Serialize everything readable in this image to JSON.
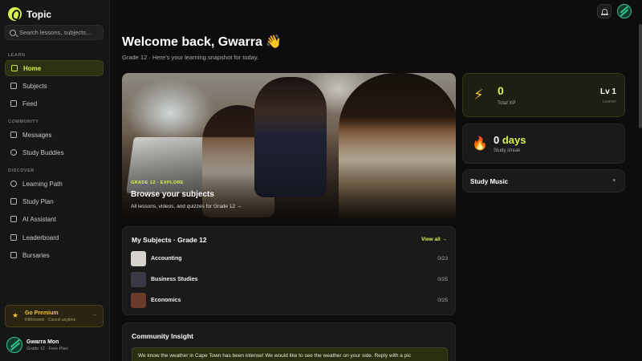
{
  "app": {
    "name": "Topic"
  },
  "search": {
    "placeholder": "Search lessons, subjects..."
  },
  "sidebar": {
    "sections": [
      {
        "label": "LEARN",
        "items": [
          "Home",
          "Subjects",
          "Feed"
        ]
      },
      {
        "label": "COMMUNITY",
        "items": [
          "Messages",
          "Study Buddies"
        ]
      },
      {
        "label": "DISCOVER",
        "items": [
          "Learning Path",
          "Study Plan",
          "AI Assistant",
          "Leaderboard",
          "Bursaries"
        ]
      }
    ],
    "active_item": "Home",
    "premium": {
      "title": "Go Premium",
      "subtitle": "R60/month · Cancel anytime",
      "arrow": "→"
    },
    "user": {
      "name": "Gwarra Mon",
      "plan": "Grade 12 · Free Plan"
    }
  },
  "header": {
    "title": "Welcome back, Gwarra 👋",
    "subtitle": "Grade 12 · Here's your learning snapshot for today."
  },
  "hero": {
    "tag": "GRADE 12 · EXPLORE",
    "title": "Browse your subjects",
    "subtitle": "All lessons, videos, and quizzes for Grade 12 →"
  },
  "subjects": {
    "title": "My Subjects · Grade 12",
    "view_all": "View all →",
    "rows": [
      {
        "name": "Accounting",
        "count": "0/23",
        "thumb_color": "#d6d3cf"
      },
      {
        "name": "Business Studies",
        "count": "0/25",
        "thumb_color": "#3a3a44"
      },
      {
        "name": "Economics",
        "count": "0/25",
        "thumb_color": "#6b3a2a"
      }
    ]
  },
  "insight": {
    "title": "Community Insight",
    "message": "We know the weather in Cape Town has been intense! We would like to see the weather on your side. Reply with a pic"
  },
  "stats": {
    "xp": {
      "value": "0",
      "label": "Total XP",
      "level": "Lv 1",
      "level_sub": "Learner"
    },
    "streak": {
      "number": "0",
      "unit": "days",
      "label": "Study streak"
    },
    "music": {
      "title": "Study Music",
      "chevron": "▾"
    }
  },
  "colors": {
    "accent": "#d8f24b",
    "background": "#0d0d0d",
    "premium": "#f2c230"
  },
  "icons": {
    "bell": "bell-icon",
    "search": "search-icon",
    "bolt": "lightning-icon",
    "flame": "flame-icon"
  }
}
